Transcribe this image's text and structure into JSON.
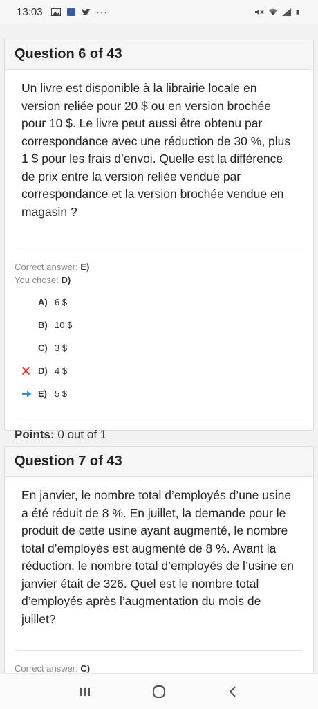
{
  "status_bar": {
    "time": "13:03",
    "icons_left": [
      "image-icon",
      "notification-icon",
      "twitter-icon",
      "more-icon"
    ],
    "icons_right": [
      "mute-icon",
      "wifi-icon",
      "signal-icon",
      "battery-icon"
    ]
  },
  "questions": [
    {
      "title": "Question 6 of 43",
      "text": "Un livre est disponible à la librairie locale en version reliée pour 20 $ ou en version brochée pour 10 $. Le livre peut aussi être obtenu par correspondance avec une réduction de 30 %, plus 1 $ pour les frais d’envoi. Quelle est la différence de prix entre la version reliée vendue par correspondance et la version brochée vendue en magasin ?",
      "correct_label": "Correct answer:",
      "correct_value": "E)",
      "chose_label": "You chose:",
      "chose_value": "D)",
      "answers": [
        {
          "letter": "A)",
          "text": "6 $",
          "mark": ""
        },
        {
          "letter": "B)",
          "text": "10 $",
          "mark": ""
        },
        {
          "letter": "C)",
          "text": "3 $",
          "mark": ""
        },
        {
          "letter": "D)",
          "text": "4 $",
          "mark": "wrong"
        },
        {
          "letter": "E)",
          "text": "5 $",
          "mark": "correct"
        }
      ],
      "points_label": "Points:",
      "points_value": "0 out of 1"
    },
    {
      "title": "Question 7 of 43",
      "text": "En janvier, le nombre total d’employés d’une usine a été réduit de 8 %. En juillet, la demande pour le produit de cette usine ayant augmenté, le nombre total d’employés est augmenté de 8 %. Avant la réduction, le nombre total d’employés de l’usine en janvier était de 326. Quel est le nombre total d’employés après l’augmentation du mois de juillet?",
      "correct_label": "Correct answer:",
      "correct_value": "C)"
    }
  ],
  "colors": {
    "wrong": "#e53935",
    "correct": "#2e8bd8"
  },
  "nav": {
    "recents": "recents-icon",
    "home": "home-icon",
    "back": "back-icon"
  }
}
